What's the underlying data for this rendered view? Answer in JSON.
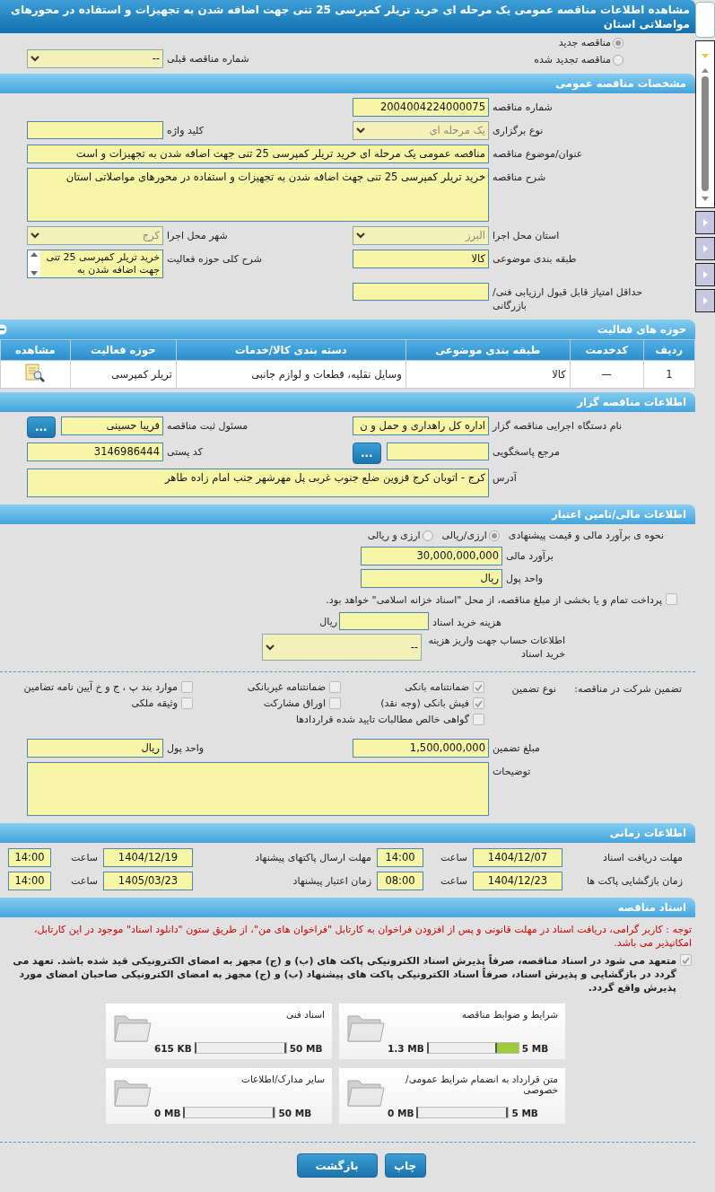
{
  "title": "مشاهده اطلاعات مناقصه عمومی یک مرحله ای خرید تریلر کمپرسی 25 تنی جهت اضافه شدن به تجهیزات و استفاده در محورهای مواصلاتی استان",
  "tender_type": {
    "options": [
      {
        "label": "مناقصه جدید",
        "selected": true
      },
      {
        "label": "مناقصه تجدید شده",
        "selected": false
      }
    ],
    "previous": {
      "label": "شماره مناقصه قبلی",
      "kind": "select",
      "value": "--",
      "disabled": false
    }
  },
  "general": {
    "heading": "مشخصات مناقصه عمومی",
    "rows": [
      [
        {
          "label": "شماره مناقصه",
          "kind": "input",
          "value": "2004004224000075"
        }
      ],
      [
        {
          "label": "نوع برگزاری",
          "kind": "select",
          "value": "یک مرحله ای",
          "disabled": true
        },
        {
          "label": "کلید واژه",
          "kind": "input"
        }
      ],
      [
        {
          "label": "عنوان/موضوع مناقصه",
          "kind": "wide_input",
          "value": "مناقصه عمومی یک مرحله ای خرید تریلر کمپرسی 25 تنی جهت اضافه شدن به تجهیزات و است"
        }
      ],
      [
        {
          "label": "شرح مناقصه",
          "kind": "textarea",
          "value": "خرید تریلر کمپرسی 25 تنی جهت اضافه شدن به تجهیزات و استفاده در محورهای مواصلاتی استان"
        }
      ],
      [
        {
          "label": "استان محل اجرا",
          "kind": "select",
          "value": "البرز",
          "disabled": true
        },
        {
          "label": "شهر محل اجرا",
          "kind": "select",
          "value": "کرج",
          "disabled": true
        }
      ],
      [
        {
          "label": "طبقه بندی موضوعی",
          "kind": "input",
          "value": "کالا"
        },
        {
          "label": "شرح کلی حوزه فعالیت",
          "kind": "scrollarea",
          "value": "خرید تریلر کمپرسی 25 تنی جهت اضافه شدن به"
        }
      ],
      [
        {
          "label": "حداقل امتیاز قابل قبول ارزیابی فنی/بازرگانی",
          "kind": "input"
        }
      ]
    ]
  },
  "activities": {
    "heading": "حوزه های فعالیت",
    "columns": [
      "ردیف",
      "کدخدمت",
      "طبقه بندی موضوعی",
      "دسته بندی کالا/خدمات",
      "حوزه فعالیت",
      "مشاهده"
    ],
    "rows": [
      [
        "1",
        "—",
        "کالا",
        "وسایل نقلیه، قطعات و لوازم جانبی",
        "تریلر کمپرسی"
      ]
    ]
  },
  "tenderer": {
    "heading": "اطلاعات مناقصه گزار",
    "rows": [
      [
        {
          "label": "نام دستگاه اجرایی مناقصه گزار",
          "kind": "input",
          "value": "اداره کل راهداری و حمل و ن"
        },
        {
          "label": "مسئول ثبت مناقصه",
          "kind": "input_button",
          "value": "فریبا حسینی",
          "button": "..."
        }
      ],
      [
        {
          "label": "مرجع پاسخگویی",
          "kind": "input_button",
          "button": "..."
        },
        {
          "label": "کد پستی",
          "kind": "input",
          "value": "3146986444"
        }
      ],
      [
        {
          "label": "آدرس",
          "kind": "wide_area",
          "value": "کرج - اتوبان کرج قزوین ضلع جنوب غربی پل مهرشهر جنب امام زاده طاهر"
        }
      ]
    ]
  },
  "finance": {
    "heading": "اطلاعات مالی/تامین اعتبار",
    "method_label": "نحوه ی برآورد مالی و قیمت پیشنهادی",
    "methods": [
      {
        "label": "ارزی/ریالی",
        "selected": true
      },
      {
        "label": "ارزی و ریالی",
        "selected": false
      }
    ],
    "estimate": {
      "label": "برآورد مالی",
      "value": "30,000,000,000"
    },
    "currency": {
      "label": "واحد پول",
      "value": "ریال"
    },
    "treasury": {
      "label": "پرداخت تمام و یا بخشی از مبلغ مناقصه، از محل \"اسناد خزانه اسلامی\" خواهد بود.",
      "checked": false
    },
    "doc_fee": {
      "label": "هزینه خرید اسناد",
      "unit": "ریال"
    },
    "account": {
      "label": "اطلاعات حساب جهت واریز هزینه خرید اسناد",
      "value": "--"
    }
  },
  "guarantee": {
    "title": "تضمین شرکت در مناقصه:",
    "type_label": "نوع تضمین",
    "options": [
      [
        {
          "label": "ضمانتنامه بانکی",
          "checked": true
        },
        {
          "label": "ضمانتنامه غیربانکی",
          "checked": false
        },
        {
          "label": "موارد بند پ ، ج و خ آیین نامه تضامین",
          "checked": false
        }
      ],
      [
        {
          "label": "فیش بانکی (وجه نقد)",
          "checked": true
        },
        {
          "label": "اوراق مشارکت",
          "checked": false
        },
        {
          "label": "وثیقه ملکی",
          "checked": false
        }
      ],
      [
        {
          "label": "گواهی خالص مطالبات تایید شده قراردادها",
          "checked": false
        }
      ]
    ],
    "rows": [
      [
        {
          "label": "مبلغ تضمین",
          "kind": "input",
          "value": "1,500,000,000"
        },
        {
          "label": "واحد پول",
          "kind": "input",
          "value": "ریال"
        }
      ],
      [
        {
          "label": "توضیحات",
          "kind": "wide_area"
        }
      ]
    ]
  },
  "timing": {
    "heading": "اطلاعات زمانی",
    "rows": [
      [
        {
          "label": "مهلت دریافت اسناد",
          "date": "1404/12/07",
          "time_label": "ساعت",
          "time": "14:00"
        },
        {
          "label": "مهلت ارسال پاکتهای پیشنهاد",
          "date": "1404/12/19",
          "time_label": "ساعت",
          "time": "14:00"
        }
      ],
      [
        {
          "label": "زمان بازگشایی پاکت ها",
          "date": "1404/12/23",
          "time_label": "ساعت",
          "time": "08:00"
        },
        {
          "label": "زمان اعتبار پیشنهاد",
          "date": "1405/03/23",
          "time_label": "ساعت",
          "time": "14:00"
        }
      ]
    ]
  },
  "documents": {
    "heading": "اسناد مناقصه",
    "notice": "توجه : کاربر گرامی، دریافت اسناد در مهلت قانونی و پس از افزودن فراخوان به کارتابل \"فراخوان های من\"، از طریق ستون \"دانلود اسناد\" موجود در این کارتابل، امکانپذیر می باشد.",
    "commitment": {
      "text": "متعهد می شود در اسناد مناقصه، صرفاً پذیرش اسناد الکترونیکی پاکت های (ب) و (ج) مجهز به امضای الکترونیکی قید شده باشد. تعهد می گردد در بازگشایی و پذیرش اسناد، صرفاً اسناد الکترونیکی پاکت های پیشنهاد (ب) و (ج) مجهز به امضای الکترونیکی صاحبان امضای مورد پذیرش واقع گردد.",
      "checked": true
    },
    "files": [
      {
        "title": "شرایط و ضوابط مناقصه",
        "max": "5 MB",
        "used": "1.3 MB",
        "level": 0.26
      },
      {
        "title": "اسناد فنی",
        "max": "50 MB",
        "used": "615 KB",
        "level": 0.012
      },
      {
        "title": "متن قرارداد به انضمام شرایط عمومی/خصوصی",
        "max": "5 MB",
        "used": "0 MB",
        "level": 0
      },
      {
        "title": "سایر مدارک/اطلاعات",
        "max": "50 MB",
        "used": "0 MB",
        "level": 0
      }
    ]
  },
  "buttons": [
    "چاپ",
    "بازگشت"
  ]
}
